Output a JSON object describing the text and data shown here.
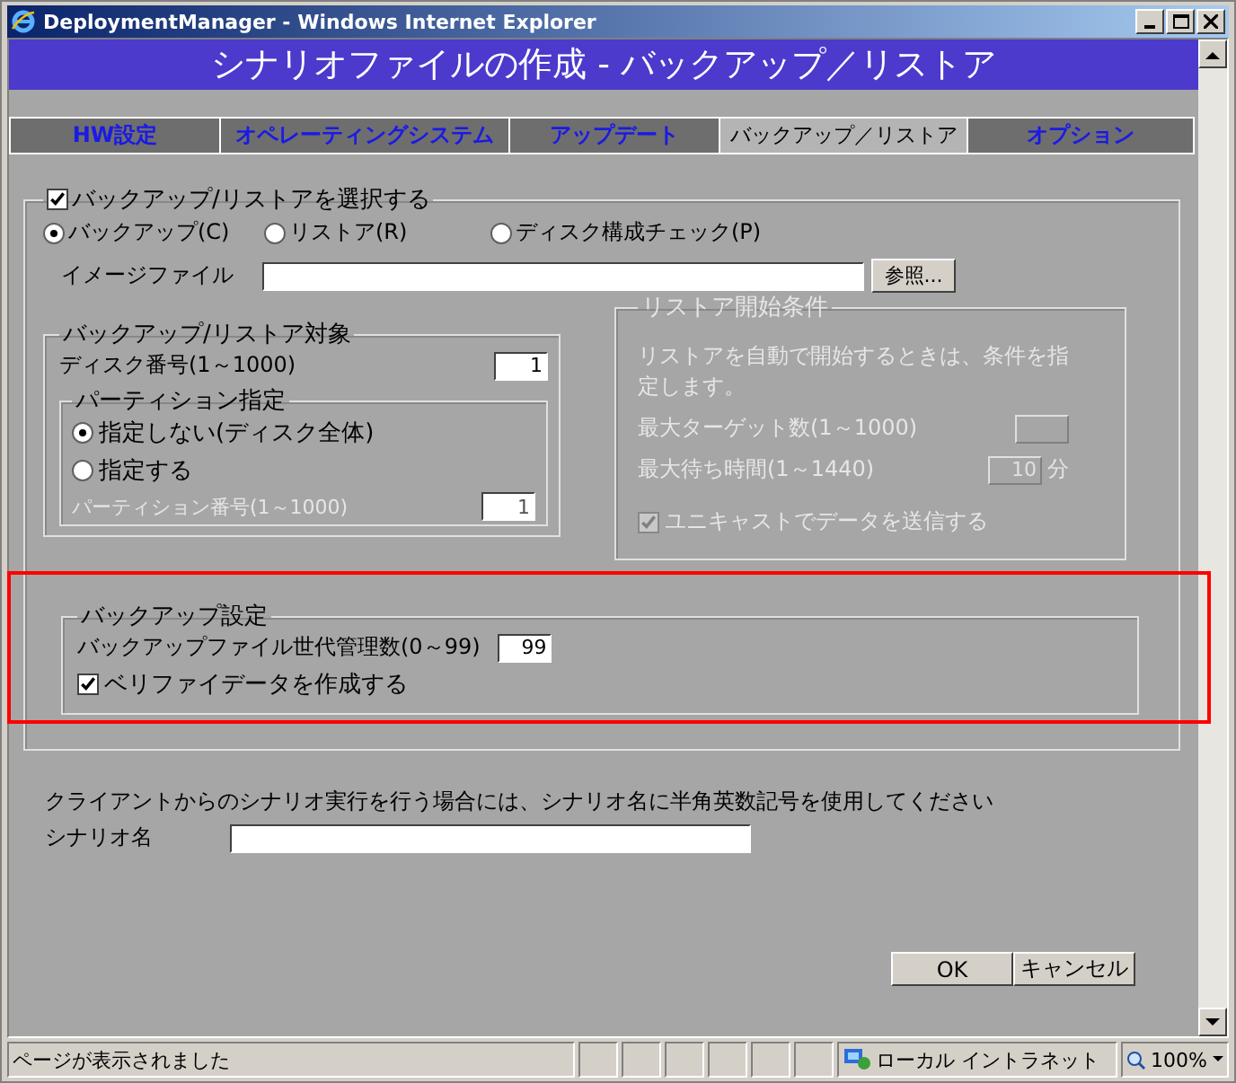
{
  "window": {
    "title": "DeploymentManager - Windows Internet Explorer"
  },
  "header": {
    "title": "シナリオファイルの作成 - バックアップ／リストア"
  },
  "tabs": [
    {
      "label": "HW設定",
      "selected": false
    },
    {
      "label": "オペレーティングシステム",
      "selected": false
    },
    {
      "label": "アップデート",
      "selected": false
    },
    {
      "label": "バックアップ／リストア",
      "selected": true
    },
    {
      "label": "オプション",
      "selected": false
    }
  ],
  "backup_restore": {
    "label": "バックアップ/リストアを選択する",
    "checked": true,
    "modes": [
      {
        "label": "バックアップ(C)",
        "selected": true
      },
      {
        "label": "リストア(R)",
        "selected": false
      },
      {
        "label": "ディスク構成チェック(P)",
        "selected": false
      }
    ],
    "image_file_label": "イメージファイル",
    "browse_button": "参照...",
    "target": {
      "title": "バックアップ/リストア対象",
      "disk_label": "ディスク番号(1～1000)",
      "disk_value": "1",
      "partition": {
        "title": "パーティション指定",
        "options": [
          {
            "label": "指定しない(ディスク全体)",
            "selected": true
          },
          {
            "label": "指定する",
            "selected": false
          }
        ],
        "number_label": "パーティション番号(1～1000)",
        "number_value": "1",
        "number_disabled": true
      }
    },
    "restore_start": {
      "title": "リストア開始条件",
      "disabled": true,
      "description": "リストアを自動で開始するときは、条件を指定します。",
      "max_targets_label": "最大ターゲット数(1～1000)",
      "max_wait_label": "最大待ち時間(1～1440)",
      "max_wait_value": "10",
      "max_wait_unit": "分",
      "unicast": {
        "label": "ユニキャストでデータを送信する",
        "checked": true
      }
    },
    "backup_settings": {
      "title": "バックアップ設定",
      "highlighted": true,
      "generations_label": "バックアップファイル世代管理数(0～99)",
      "generations_value": "99",
      "verify": {
        "label": "ベリファイデータを作成する",
        "checked": true
      }
    }
  },
  "note": "クライアントからのシナリオ実行を行う場合には、シナリオ名に半角英数記号を使用してください",
  "scenario_name_label": "シナリオ名",
  "buttons": [
    "OK",
    "キャンセル"
  ],
  "status_bar": {
    "message": "ページが表示されました",
    "zone": "ローカル イントラネット",
    "zoom": "100%"
  }
}
